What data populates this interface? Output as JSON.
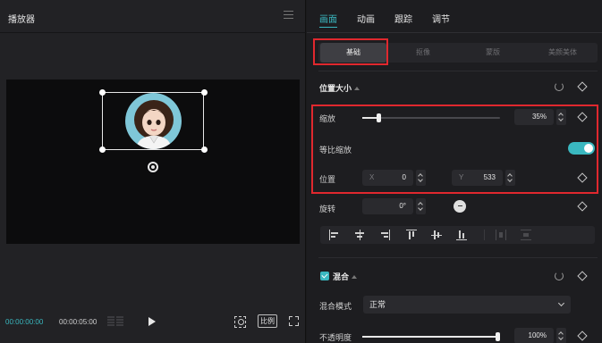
{
  "player": {
    "title": "播放器",
    "current_time": "00:00:00:00",
    "total_time": "00:00:05:00",
    "ratio_label": "比例"
  },
  "inspector": {
    "top_tabs": [
      {
        "label": "画面",
        "active": true
      },
      {
        "label": "动画",
        "active": false
      },
      {
        "label": "跟踪",
        "active": false
      },
      {
        "label": "调节",
        "active": false
      }
    ],
    "sub_tabs": [
      {
        "label": "基础",
        "active": true
      },
      {
        "label": "抠像",
        "active": false
      },
      {
        "label": "蒙版",
        "active": false
      },
      {
        "label": "美颜美体",
        "active": false
      }
    ],
    "position_size": {
      "title": "位置大小",
      "scale_label": "缩放",
      "scale_value": "35%",
      "scale_fraction": 0.12,
      "uniform_scale_label": "等比缩放",
      "uniform_scale_on": true,
      "position_label": "位置",
      "x_prefix": "X",
      "x_value": "0",
      "y_prefix": "Y",
      "y_value": "533",
      "rotation_label": "旋转",
      "rotation_value": "0°"
    },
    "blend": {
      "title": "混合",
      "checked": true,
      "mode_label": "混合模式",
      "mode_value": "正常",
      "opacity_label": "不透明度",
      "opacity_value": "100%",
      "opacity_fraction": 1.0
    }
  },
  "colors": {
    "accent": "#3ab8c0",
    "highlight_box": "#e0282e",
    "panel_bg": "#1d1d20",
    "canvas_bg": "#0c0c0d"
  }
}
